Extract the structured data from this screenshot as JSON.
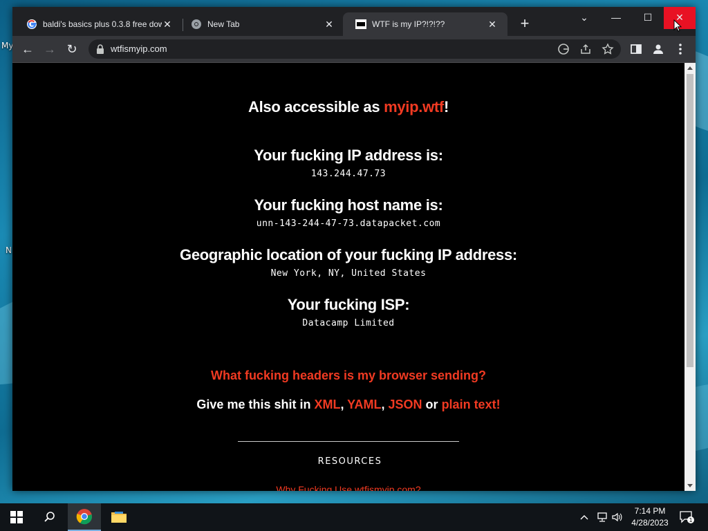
{
  "desktop": {
    "icon_labels": [
      "My",
      "N"
    ]
  },
  "browser": {
    "tabs": [
      {
        "title": "baldi's basics plus 0.3.8 free dow",
        "close": "✕"
      },
      {
        "title": "New Tab",
        "close": "✕"
      },
      {
        "title": "WTF is my IP?!?!??",
        "close": "✕"
      }
    ],
    "new_tab": "+",
    "window_controls": {
      "dropdown": "⌄",
      "minimize": "—",
      "maximize": "☐",
      "close": "✕"
    },
    "nav": {
      "back": "←",
      "forward": "→",
      "reload": "↻"
    },
    "url": "wtfismyip.com"
  },
  "page": {
    "accessible_prefix": "Also accessible as ",
    "accessible_link": "myip.wtf",
    "accessible_suffix": "!",
    "ip_heading": "Your fucking IP address is:",
    "ip_value": "143.244.47.73",
    "host_heading": "Your fucking host name is:",
    "host_value": "unn-143-244-47-73.datapacket.com",
    "geo_heading": "Geographic location of your fucking IP address:",
    "geo_value": "New York, NY, United States",
    "isp_heading": "Your fucking ISP:",
    "isp_value": "Datacamp Limited",
    "headers_link": "What fucking headers is my browser sending?",
    "format_prefix": "Give me this shit in ",
    "format_xml": "XML",
    "format_sep1": ", ",
    "format_yaml": "YAML",
    "format_sep2": ", ",
    "format_json": "JSON",
    "format_or": " or ",
    "format_text": "plain text!",
    "resources_heading": "RESOURCES",
    "why_link": "Why Fucking Use wtfismyip.com?"
  },
  "taskbar": {
    "time": "7:14 PM",
    "date": "4/28/2023",
    "notification_count": "1"
  },
  "colors": {
    "accent": "#f13a22",
    "close_button": "#e81123",
    "page_bg": "#000000"
  }
}
